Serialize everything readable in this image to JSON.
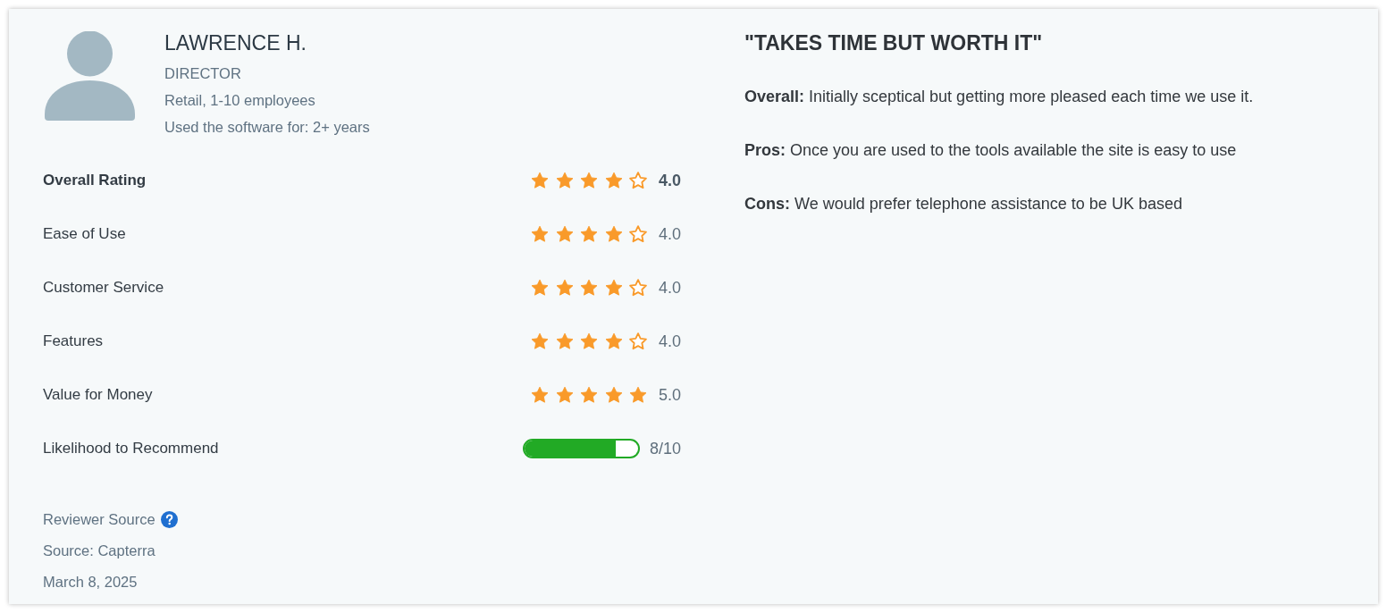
{
  "reviewer": {
    "name": "LAWRENCE H.",
    "role": "DIRECTOR",
    "company": "Retail, 1-10 employees",
    "usage": "Used the software for: 2+ years"
  },
  "ratings": [
    {
      "kind": "stars",
      "label": "Overall Rating",
      "emphasized": true,
      "stars": 4,
      "value": "4.0"
    },
    {
      "kind": "stars",
      "label": "Ease of Use",
      "emphasized": false,
      "stars": 4,
      "value": "4.0"
    },
    {
      "kind": "stars",
      "label": "Customer Service",
      "emphasized": false,
      "stars": 4,
      "value": "4.0"
    },
    {
      "kind": "stars",
      "label": "Features",
      "emphasized": false,
      "stars": 4,
      "value": "4.0"
    },
    {
      "kind": "stars",
      "label": "Value for Money",
      "emphasized": false,
      "stars": 5,
      "value": "5.0"
    },
    {
      "kind": "bar",
      "label": "Likelihood to Recommend",
      "emphasized": false,
      "level": 0.8,
      "value": "8/10"
    }
  ],
  "source": {
    "label": "Reviewer Source",
    "source": "Source: Capterra",
    "date": "March 8, 2025"
  },
  "review": {
    "title": "\"TAKES TIME BUT WORTH IT\"",
    "paragraphs": [
      "**Overall:** Initially sceptical but getting more pleased each time we use it.",
      "**Pros:** Once you are used to the tools available the site is easy to use",
      "**Cons:** We would prefer telephone assistance to be UK based"
    ]
  }
}
